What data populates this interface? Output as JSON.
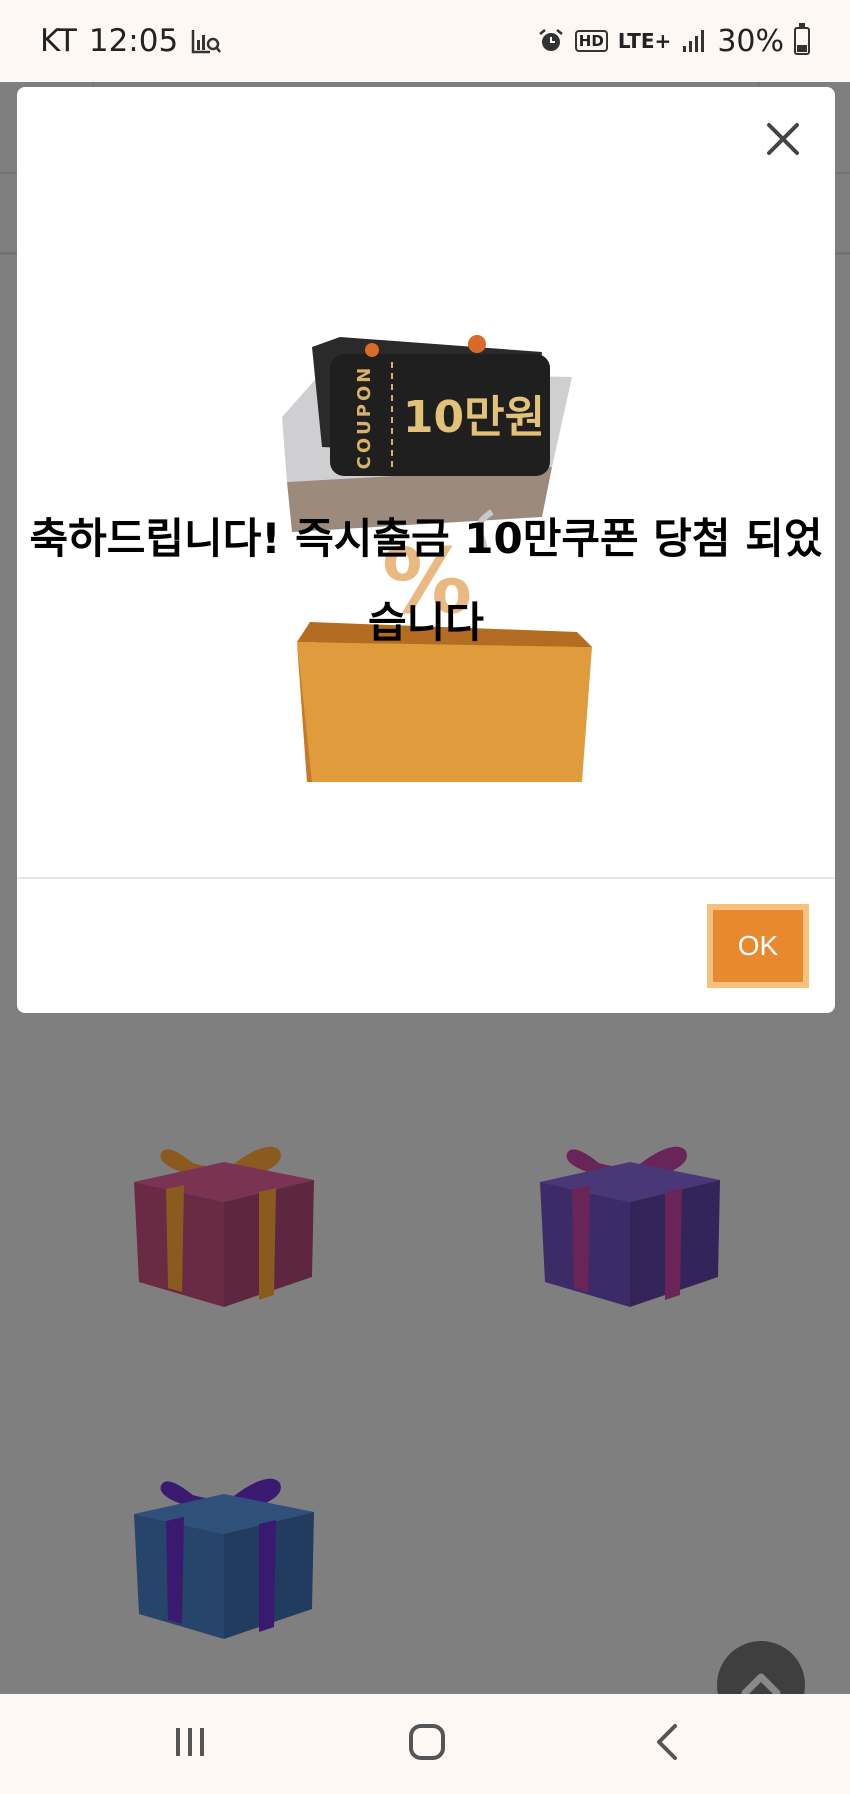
{
  "status_bar": {
    "carrier": "KT",
    "time": "12:05",
    "hd": "HD",
    "network": "LTE+",
    "battery": "30%",
    "battery_level": 0.3,
    "icons": [
      "chart-search-icon",
      "alarm-icon",
      "hd-voice-icon",
      "lte-icon",
      "signal-icon",
      "battery-icon"
    ]
  },
  "modal": {
    "close_icon": "close-icon",
    "image": {
      "coupon_label": "COUPON",
      "coupon_value": "10만원",
      "percent": "%"
    },
    "message": "축하드립니다! 즉시출금 10만쿠폰 당첨 되었습니다",
    "ok_label": "OK"
  },
  "background": {
    "gifts": [
      {
        "name": "gift-red",
        "box": "#6a2a44",
        "ribbon": "#8a5a1e"
      },
      {
        "name": "gift-purple",
        "box": "#3c2b66",
        "ribbon": "#6a2558"
      },
      {
        "name": "gift-blue",
        "box": "#27456a",
        "ribbon": "#3a1a70"
      }
    ],
    "scroll_top_icon": "chevron-up-icon"
  },
  "colors": {
    "overlay": "#7f7f7f",
    "ok_button": "#e8892f",
    "ok_border": "#f6c07f"
  },
  "nav_bar": {
    "icons": [
      "recent-apps-icon",
      "home-icon",
      "back-icon"
    ]
  }
}
